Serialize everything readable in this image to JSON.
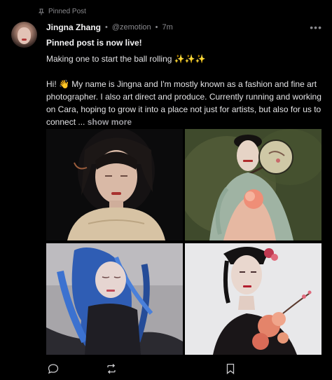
{
  "pinned": {
    "label": "Pinned Post",
    "icon": "pin-icon"
  },
  "author": {
    "name": "Jingna Zhang",
    "handle": "@zemotion",
    "time": "7m"
  },
  "post": {
    "title": "Pinned post is now live!",
    "line1": "Making one to start the ball rolling ✨✨✨",
    "line2": "Hi! 👋 My name is Jingna and I'm mostly known as a fashion and fine art photographer. I also art direct and produce. Currently running and working on Cara, hoping to grow it into a place not just for artists, but also for us to connect ...",
    "show_more": "show more"
  },
  "images": [
    {
      "icon": "portrait-photo-1"
    },
    {
      "icon": "portrait-photo-2"
    },
    {
      "icon": "portrait-photo-3"
    },
    {
      "icon": "portrait-photo-4"
    }
  ],
  "actions": [
    "comment-icon",
    "repost-icon",
    "bookmark-icon"
  ],
  "colors": {
    "background": "#000000",
    "muted": "#8a8a8e",
    "text": "#e9e9ea"
  }
}
